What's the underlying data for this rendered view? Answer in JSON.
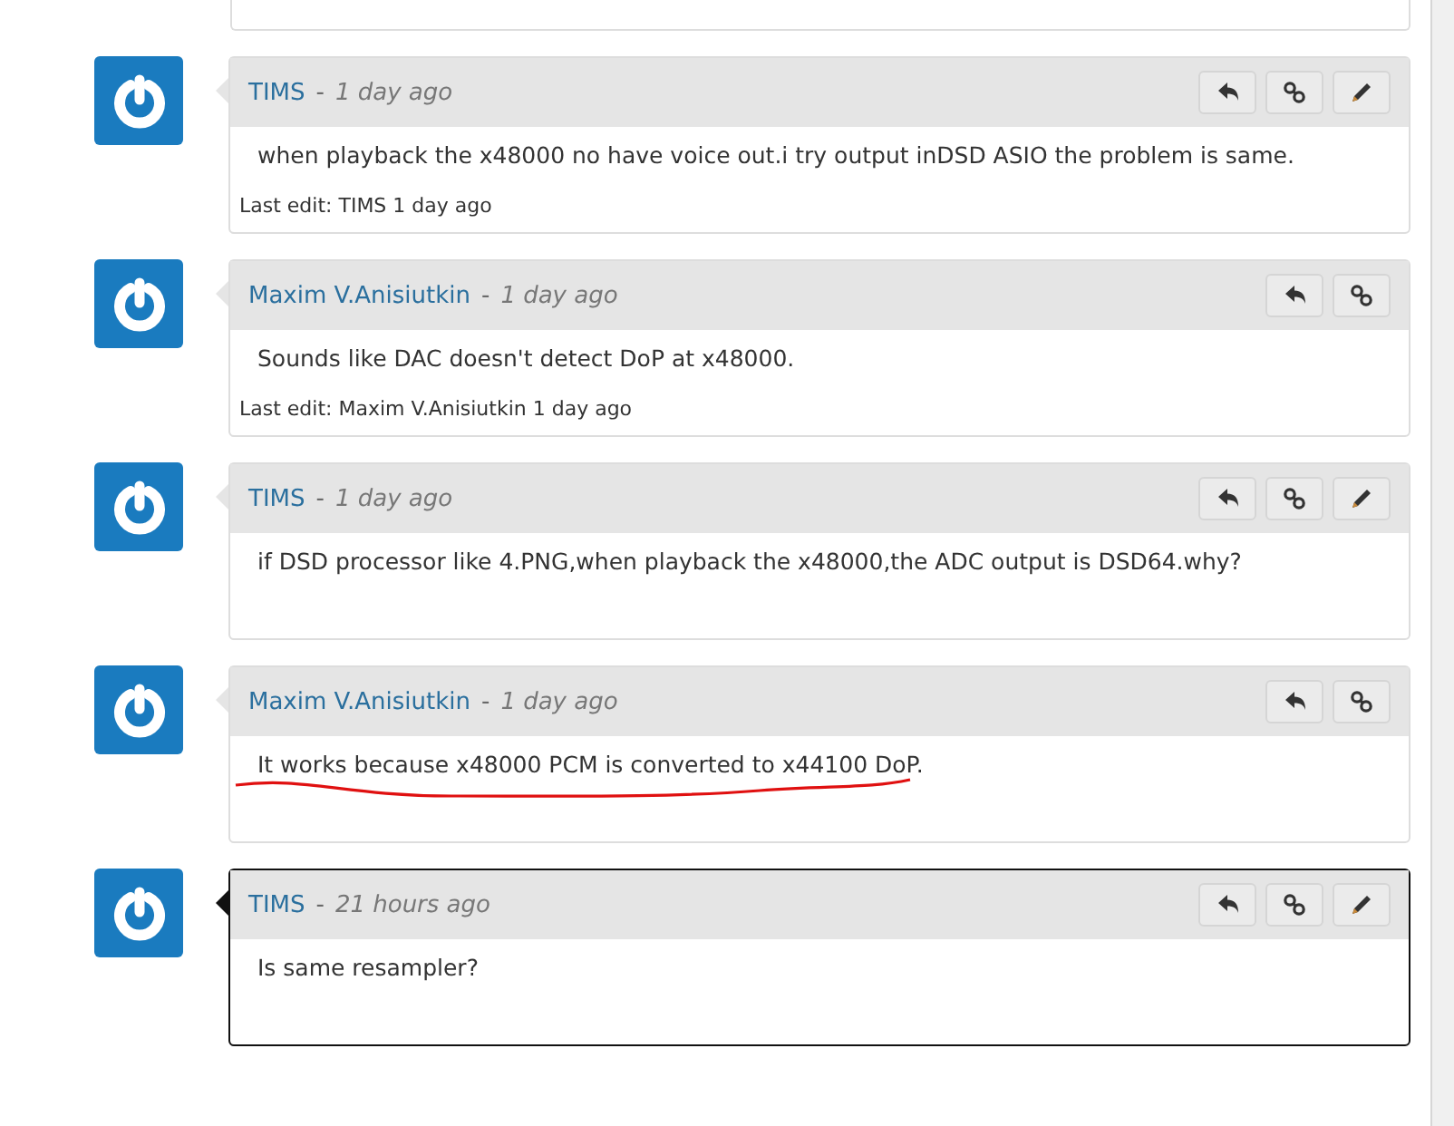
{
  "posts": [
    {
      "author": "TIMS",
      "separator": "-",
      "time": "1 day ago",
      "body": "when playback the x48000 no have voice out.i try output inDSD ASIO the problem is same.",
      "last_edit": "Last edit: TIMS 1 day ago",
      "actions": [
        {
          "kind": "reply"
        },
        {
          "kind": "link"
        },
        {
          "kind": "edit"
        }
      ],
      "selected": false
    },
    {
      "author": "Maxim V.Anisiutkin",
      "separator": "-",
      "time": "1 day ago",
      "body": "Sounds like DAC doesn't detect DoP at x48000.",
      "last_edit": "Last edit: Maxim V.Anisiutkin 1 day ago",
      "actions": [
        {
          "kind": "reply"
        },
        {
          "kind": "link"
        }
      ],
      "selected": false
    },
    {
      "author": "TIMS",
      "separator": "-",
      "time": "1 day ago",
      "body": "if DSD processor like 4.PNG,when playback the x48000,the ADC output is DSD64.why?",
      "actions": [
        {
          "kind": "reply"
        },
        {
          "kind": "link"
        },
        {
          "kind": "edit"
        }
      ],
      "selected": false
    },
    {
      "author": "Maxim V.Anisiutkin",
      "separator": "-",
      "time": "1 day ago",
      "body": "It works because x48000 PCM is converted to x44100 DoP.",
      "actions": [
        {
          "kind": "reply"
        },
        {
          "kind": "link"
        }
      ],
      "selected": false,
      "underlined": true
    },
    {
      "author": "TIMS",
      "separator": "-",
      "time": "21 hours ago",
      "body": "Is same resampler?",
      "actions": [
        {
          "kind": "reply"
        },
        {
          "kind": "link"
        },
        {
          "kind": "edit"
        }
      ],
      "selected": true
    }
  ]
}
